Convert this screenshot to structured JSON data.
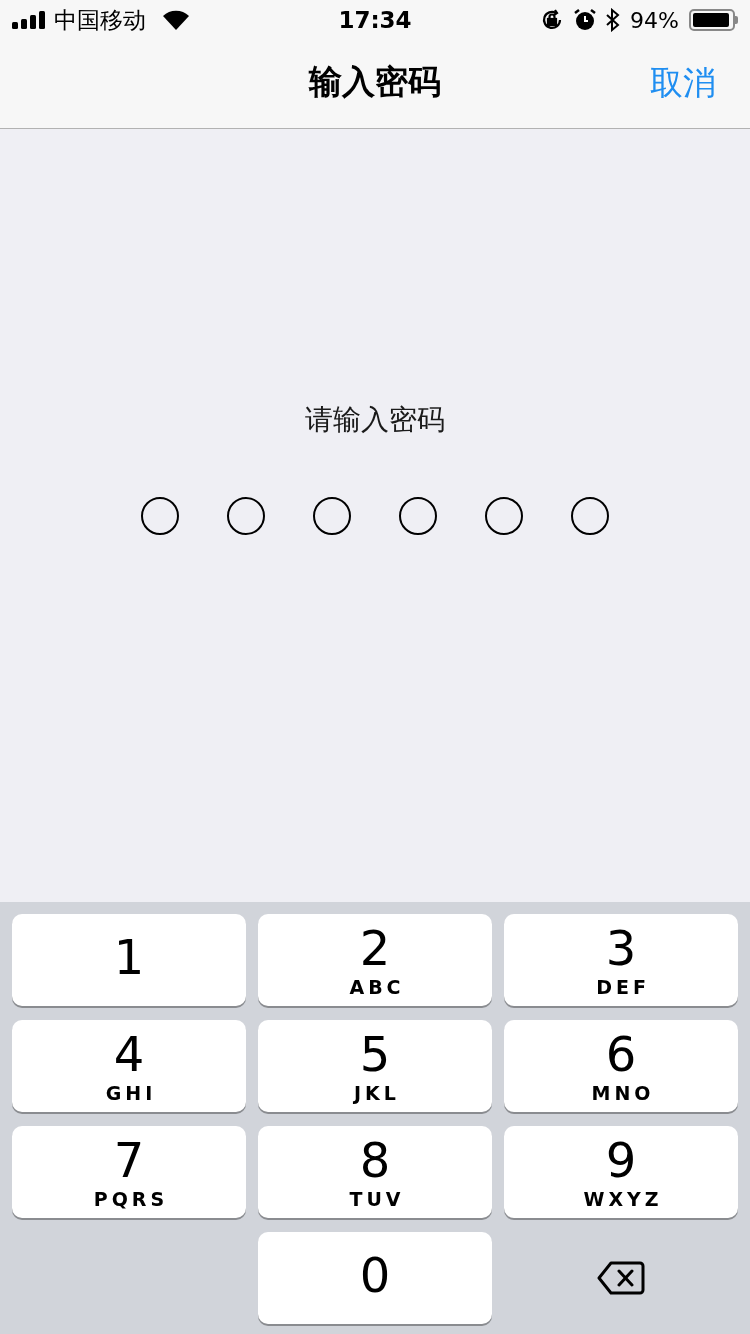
{
  "status_bar": {
    "carrier": "中国移动",
    "time": "17:34",
    "battery": "94%"
  },
  "nav": {
    "title": "输入密码",
    "cancel": "取消"
  },
  "prompt": "请输入密码",
  "passcode_dots": [
    {
      "filled": false
    },
    {
      "filled": false
    },
    {
      "filled": false
    },
    {
      "filled": false
    },
    {
      "filled": false
    },
    {
      "filled": false
    }
  ],
  "keys": [
    {
      "kind": "digit",
      "digit": "1"
    },
    {
      "kind": "digit",
      "digit": "2",
      "letters": "ABC"
    },
    {
      "kind": "digit",
      "digit": "3",
      "letters": "DEF"
    },
    {
      "kind": "digit",
      "digit": "4",
      "letters": "GHI"
    },
    {
      "kind": "digit",
      "digit": "5",
      "letters": "JKL"
    },
    {
      "kind": "digit",
      "digit": "6",
      "letters": "MNO"
    },
    {
      "kind": "digit",
      "digit": "7",
      "letters": "PQRS"
    },
    {
      "kind": "digit",
      "digit": "8",
      "letters": "TUV"
    },
    {
      "kind": "digit",
      "digit": "9",
      "letters": "WXYZ"
    },
    {
      "kind": "blank"
    },
    {
      "kind": "digit",
      "digit": "0"
    },
    {
      "kind": "delete"
    }
  ]
}
